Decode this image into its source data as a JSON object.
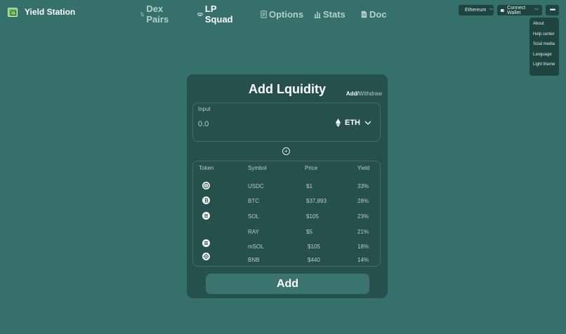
{
  "brand": {
    "name": "Yield Station"
  },
  "nav": {
    "items": [
      {
        "label": "Dex Pairs",
        "active": false
      },
      {
        "label": "LP Squad",
        "active": true
      },
      {
        "label": "Options",
        "active": false
      },
      {
        "label": "Stats",
        "active": false
      },
      {
        "label": "Doc",
        "active": false
      }
    ]
  },
  "header": {
    "network": "Ethereum",
    "wallet": "Connect Wallet",
    "more": "•••"
  },
  "menu": {
    "items": [
      "About",
      "Help center",
      "Scial media",
      "Language",
      "Light theme"
    ]
  },
  "card": {
    "title": "Add Lquidity",
    "mode_active": "Add",
    "mode_separator": "/",
    "mode_inactive": "Withdraw",
    "input_label": "Input",
    "input_value": "",
    "input_placeholder": "0.0",
    "token": "ETH",
    "plus": "+",
    "add_label": "Add"
  },
  "table": {
    "headers": [
      "Token",
      "Symbol",
      "Price",
      "Yield"
    ],
    "rows": [
      {
        "icon": "usdc-icon",
        "symbol": "USDC",
        "price": "$1",
        "yield": "33%"
      },
      {
        "icon": "bitcoin-icon",
        "symbol": "BTC",
        "price": "$37,893",
        "yield": "28%"
      },
      {
        "icon": "solana-icon",
        "symbol": "SOL",
        "price": "$105",
        "yield": "23%"
      },
      {
        "icon": "",
        "symbol": "RAY",
        "price": "$5",
        "yield": "21%"
      },
      {
        "icon": "solana-icon",
        "symbol": "mSOL",
        "price": "$105",
        "yield": "18%"
      },
      {
        "icon": "bnb-icon",
        "symbol": "BNB",
        "price": "$440",
        "yield": "14%"
      }
    ]
  },
  "colors": {
    "background": "#35706b",
    "card": "#25504b",
    "pill": "#1d4440",
    "button": "#3a746f",
    "muted_text": "#b9ccc9"
  }
}
